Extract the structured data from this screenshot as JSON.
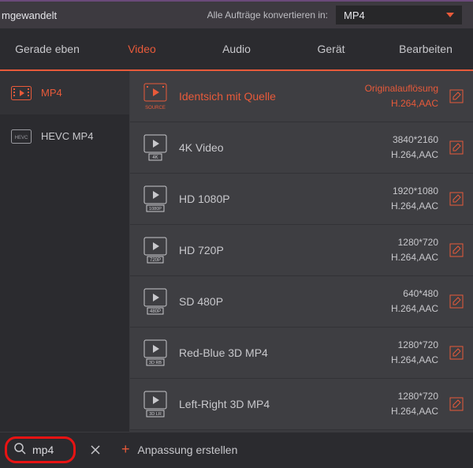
{
  "topbar": {
    "left_fragment": "mgewandelt",
    "convert_label": "Alle Aufträge konvertieren in:",
    "selected_format": "MP4"
  },
  "tabs": [
    {
      "label": "Gerade eben",
      "active": false
    },
    {
      "label": "Video",
      "active": true
    },
    {
      "label": "Audio",
      "active": false
    },
    {
      "label": "Gerät",
      "active": false
    },
    {
      "label": "Bearbeiten",
      "active": false
    }
  ],
  "sidebar": {
    "items": [
      {
        "label": "MP4",
        "icon": "film-icon",
        "active": true
      },
      {
        "label": "HEVC MP4",
        "icon": "hevc-icon",
        "active": false
      }
    ]
  },
  "presets": [
    {
      "title": "Identsich mit Quelle",
      "line1": "Originalauflösung",
      "line2": "H.264,AAC",
      "badge": "SOURCE",
      "active": true
    },
    {
      "title": "4K Video",
      "line1": "3840*2160",
      "line2": "H.264,AAC",
      "badge": "4K"
    },
    {
      "title": "HD 1080P",
      "line1": "1920*1080",
      "line2": "H.264,AAC",
      "badge": "1080P"
    },
    {
      "title": "HD 720P",
      "line1": "1280*720",
      "line2": "H.264,AAC",
      "badge": "720P"
    },
    {
      "title": "SD 480P",
      "line1": "640*480",
      "line2": "H.264,AAC",
      "badge": "480P"
    },
    {
      "title": "Red-Blue 3D MP4",
      "line1": "1280*720",
      "line2": "H.264,AAC",
      "badge": "3D RB"
    },
    {
      "title": "Left-Right 3D MP4",
      "line1": "1280*720",
      "line2": "H.264,AAC",
      "badge": "3D LR"
    }
  ],
  "footer": {
    "search_value": "mp4",
    "custom_label": "Anpassung erstellen"
  },
  "colors": {
    "accent": "#e85a3a",
    "highlight_ring": "#e81313"
  }
}
